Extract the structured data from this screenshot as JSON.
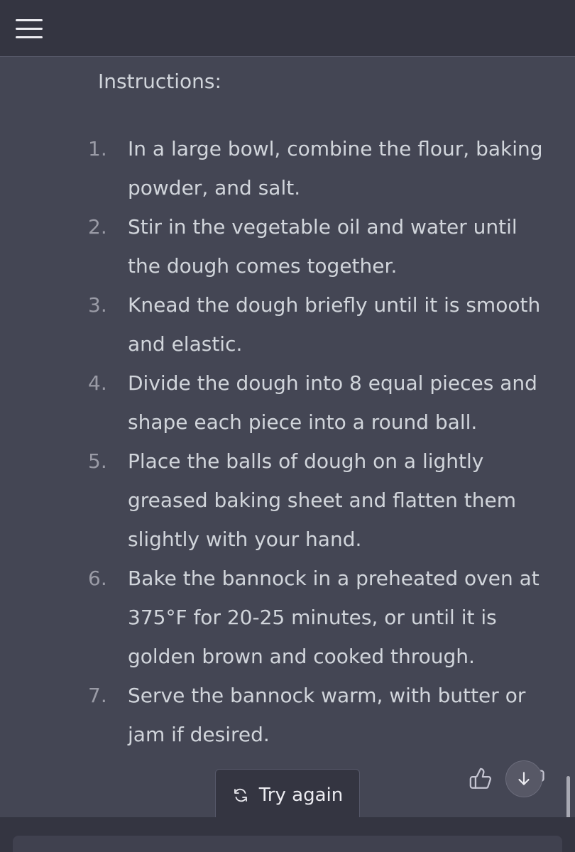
{
  "header": {
    "menu_icon": "hamburger-menu-icon"
  },
  "message": {
    "heading": "Instructions:",
    "steps": [
      {
        "number": "1.",
        "text": "In a large bowl, combine the flour, baking powder, and salt."
      },
      {
        "number": "2.",
        "text": "Stir in the vegetable oil and water until the dough comes together."
      },
      {
        "number": "3.",
        "text": "Knead the dough briefly until it is smooth and elastic."
      },
      {
        "number": "4.",
        "text": "Divide the dough into 8 equal pieces and shape each piece into a round ball."
      },
      {
        "number": "5.",
        "text": "Place the balls of dough on a lightly greased baking sheet and flatten them slightly with your hand."
      },
      {
        "number": "6.",
        "text": "Bake the bannock in a preheated oven at 375°F for 20-25 minutes, or until it is golden brown and cooked through."
      },
      {
        "number": "7.",
        "text": "Serve the bannock warm, with butter or jam if desired."
      }
    ]
  },
  "actions": {
    "try_again_label": "Try again",
    "try_again_icon": "refresh-icon",
    "thumbs_up_icon": "thumbs-up-icon",
    "scroll_down_icon": "arrow-down-icon",
    "thumbs_down_icon": "thumbs-down-icon"
  },
  "colors": {
    "background": "#444654",
    "header": "#343541",
    "text": "#d1d5db",
    "number": "#9a9ba6"
  }
}
